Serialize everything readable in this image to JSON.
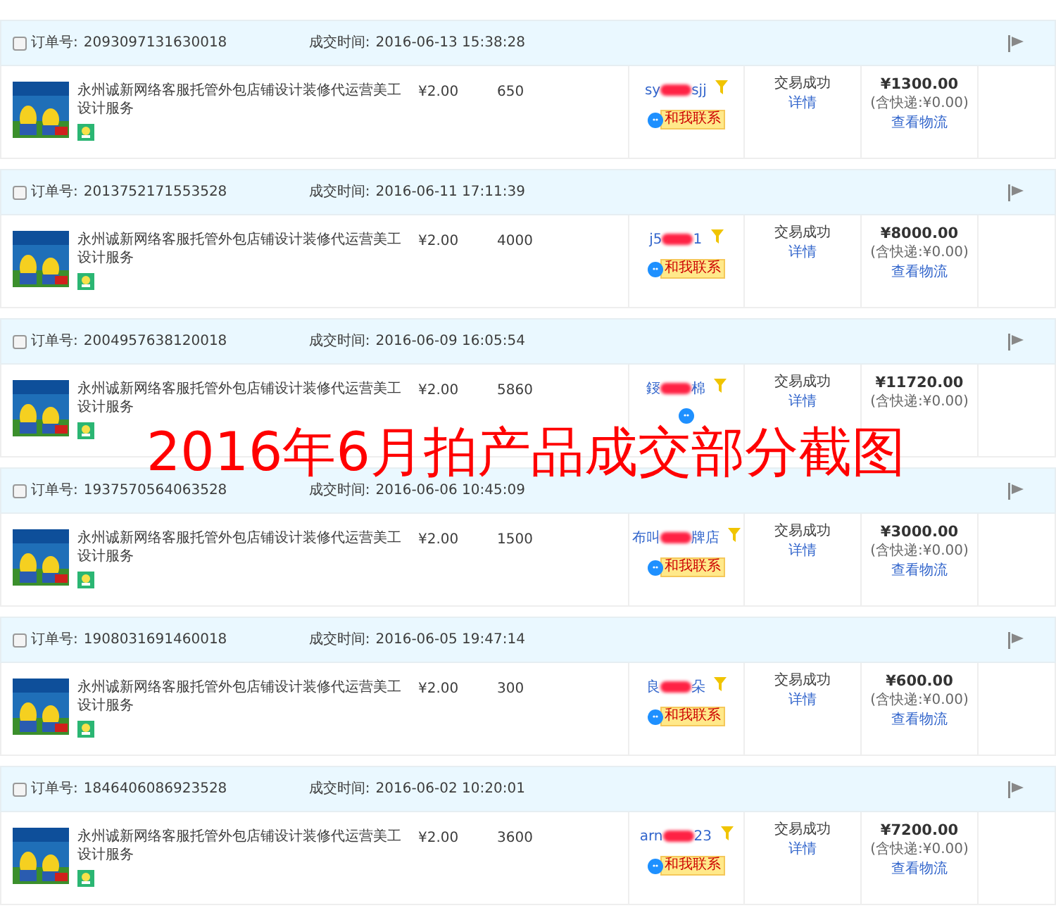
{
  "orders": [
    {
      "checked": false,
      "order_label": "订单号:",
      "order_no": "2093097131630018",
      "time_label": "成交时间:",
      "time": "2016-06-13 15:38:28",
      "item": {
        "kind": "picture",
        "title": "永州诚新网络客服托管外包店铺设计装修代运营美工设计服务"
      },
      "price": "¥2.00",
      "quantity": "650",
      "buyer_prefix": "sy",
      "buyer_suffix": "sjj",
      "contact": "和我联系",
      "status": "交易成功",
      "details": "详情",
      "total": "¥1300.00",
      "shipping": "(含快递:¥0.00)",
      "logistics": "查看物流"
    },
    {
      "checked": false,
      "order_label": "订单号:",
      "order_no": "2013752171553528",
      "time_label": "成交时间:",
      "time": "2016-06-11 17:11:39",
      "item": {
        "kind": "picture",
        "title": "永州诚新网络客服托管外包店铺设计装修代运营美工设计服务"
      },
      "price": "¥2.00",
      "quantity": "4000",
      "buyer_prefix": "j5",
      "buyer_suffix": "1",
      "contact": "和我联系",
      "status": "交易成功",
      "details": "详情",
      "total": "¥8000.00",
      "shipping": "(含快递:¥0.00)",
      "logistics": "查看物流"
    },
    {
      "checked": false,
      "order_label": "订单号:",
      "order_no": "2004957638120018",
      "time_label": "成交时间:",
      "time": "2016-06-09 16:05:54",
      "item": {
        "kind": "picture",
        "title": "永州诚新网络客服托管外包店铺设计装修代运营美工设计服务"
      },
      "price": "¥2.00",
      "quantity": "5860",
      "buyer_prefix": "鋄",
      "buyer_suffix": "棉",
      "status": "交易成功",
      "details": "详情",
      "total": "¥11720.00",
      "shipping": "(含快递:¥0.00)"
    },
    {
      "checked": false,
      "order_label": "订单号:",
      "order_no": "1937570564063528",
      "time_label": "成交时间:",
      "time": "2016-06-06 10:45:09",
      "item": {
        "kind": "picture",
        "title": "永州诚新网络客服托管外包店铺设计装修代运营美工设计服务"
      },
      "price": "¥2.00",
      "quantity": "1500",
      "buyer_prefix": "布叫",
      "buyer_suffix": "牌店",
      "contact": "和我联系",
      "status": "交易成功",
      "details": "详情",
      "total": "¥3000.00",
      "shipping": "(含快递:¥0.00)",
      "logistics": "查看物流"
    },
    {
      "checked": false,
      "order_label": "订单号:",
      "order_no": "1908031691460018",
      "time_label": "成交时间:",
      "time": "2016-06-05 19:47:14",
      "item": {
        "kind": "picture",
        "title": "永州诚新网络客服托管外包店铺设计装修代运营美工设计服务"
      },
      "price": "¥2.00",
      "quantity": "300",
      "buyer_prefix": "良",
      "buyer_suffix": "朵",
      "contact": "和我联系",
      "status": "交易成功",
      "details": "详情",
      "total": "¥600.00",
      "shipping": "(含快递:¥0.00)",
      "logistics": "查看物流"
    },
    {
      "checked": false,
      "order_label": "订单号:",
      "order_no": "1846406086923528",
      "time_label": "成交时间:",
      "time": "2016-06-02 10:20:01",
      "item": {
        "kind": "picture",
        "title": "永州诚新网络客服托管外包店铺设计装修代运营美工设计服务"
      },
      "price": "¥2.00",
      "quantity": "3600",
      "buyer_prefix": "arn",
      "buyer_suffix": "23",
      "contact": "和我联系",
      "status": "交易成功",
      "details": "详情",
      "total": "¥7200.00",
      "shipping": "(含快递:¥0.00)",
      "logistics": "查看物流"
    }
  ],
  "overlay_caption": "2016年6月拍产品成交部分截图"
}
